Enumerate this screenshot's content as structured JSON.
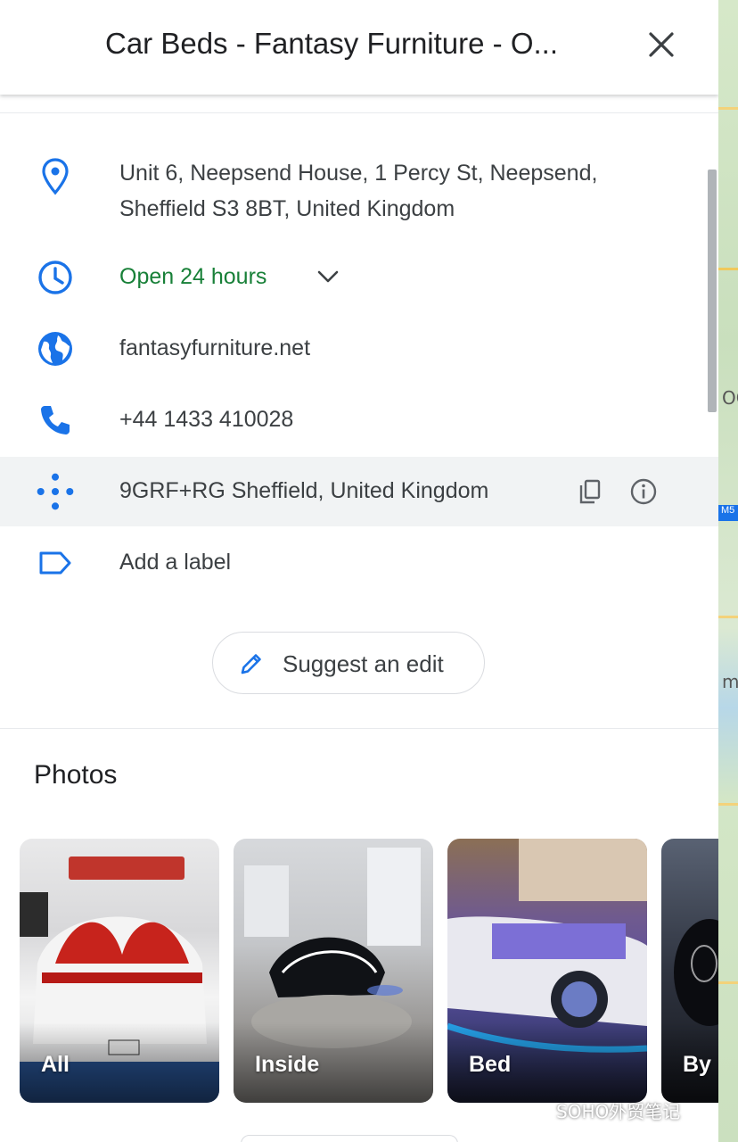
{
  "header": {
    "title": "Car Beds - Fantasy Furniture - O..."
  },
  "details": {
    "address_line1": "Unit 6, Neepsend House, 1 Percy St, Neepsend,",
    "address_line2": "Sheffield S3 8BT, United Kingdom",
    "hours": "Open 24 hours",
    "website": "fantasyfurniture.net",
    "phone": "+44 1433 410028",
    "plus_code": "9GRF+RG Sheffield, United Kingdom",
    "add_label": "Add a label"
  },
  "suggest_edit": {
    "label": "Suggest an edit"
  },
  "photos": {
    "title": "Photos",
    "items": [
      {
        "label": "All"
      },
      {
        "label": "Inside"
      },
      {
        "label": "Bed"
      },
      {
        "label": "By"
      }
    ]
  },
  "map": {
    "text1": "OC",
    "text2": "M5",
    "text3": "m"
  },
  "watermark": "SOHO外贸笔记",
  "colors": {
    "accent_blue": "#1a73e8",
    "open_green": "#188038",
    "text_primary": "#202124",
    "text_secondary": "#3c4043"
  },
  "icons": [
    "location-pin-icon",
    "clock-icon",
    "globe-icon",
    "phone-icon",
    "plus-code-icon",
    "label-icon",
    "copy-icon",
    "info-icon",
    "pencil-icon",
    "close-icon",
    "chevron-down-icon"
  ]
}
